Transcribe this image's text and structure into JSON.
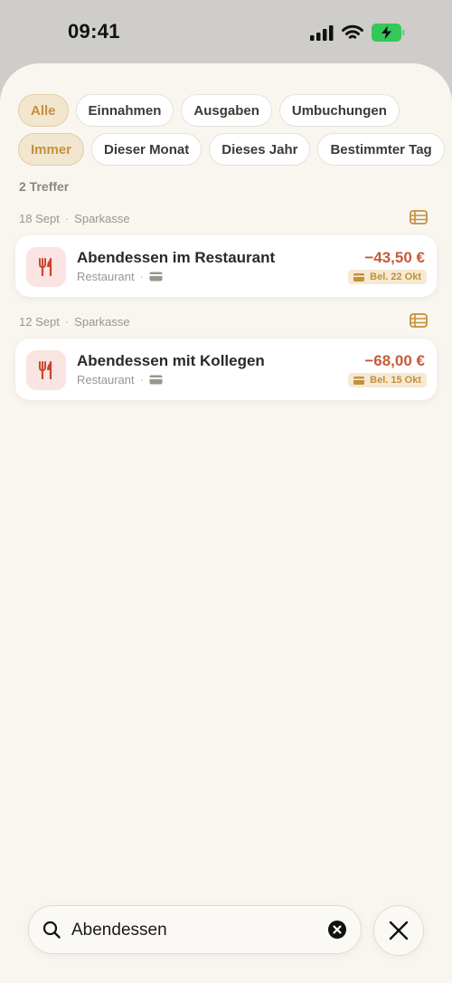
{
  "status_bar": {
    "time": "09:41"
  },
  "filters": {
    "type": [
      {
        "label": "Alle",
        "active": true
      },
      {
        "label": "Einnahmen",
        "active": false
      },
      {
        "label": "Ausgaben",
        "active": false
      },
      {
        "label": "Umbuchungen",
        "active": false
      }
    ],
    "period": [
      {
        "label": "Immer",
        "active": true
      },
      {
        "label": "Dieser Monat",
        "active": false
      },
      {
        "label": "Dieses Jahr",
        "active": false
      },
      {
        "label": "Bestimmter Tag",
        "active": false
      }
    ]
  },
  "result_count": "2 Treffer",
  "groups": [
    {
      "date": "18 Sept",
      "bank": "Sparkasse",
      "transaction": {
        "title": "Abendessen im Restaurant",
        "category": "Restaurant",
        "amount": "−43,50 €",
        "badge": "Bel. 22 Okt",
        "icon": "fork-knife-icon"
      }
    },
    {
      "date": "12 Sept",
      "bank": "Sparkasse",
      "transaction": {
        "title": "Abendessen mit Kollegen",
        "category": "Restaurant",
        "amount": "−68,00 €",
        "badge": "Bel. 15 Okt",
        "icon": "fork-knife-icon"
      }
    }
  ],
  "search": {
    "value": "Abendessen"
  },
  "colors": {
    "accent": "#c4903c",
    "expense": "#c25c39",
    "background": "#f9f6f0",
    "battery": "#34c759"
  }
}
